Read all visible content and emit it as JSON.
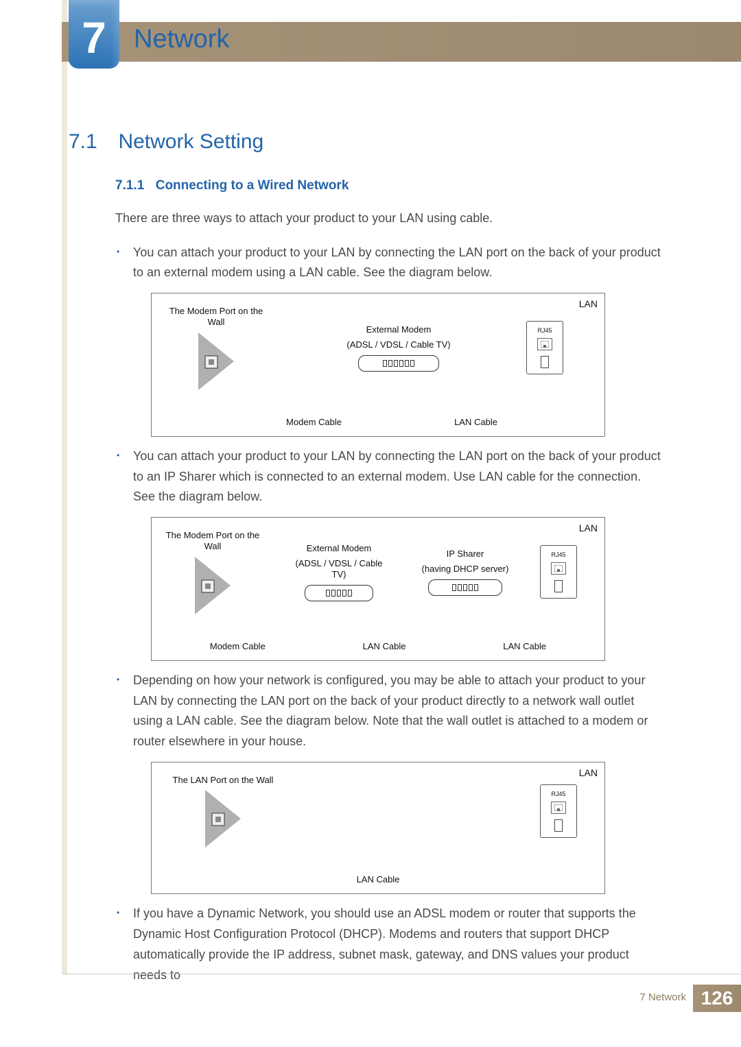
{
  "chapter": {
    "number": "7",
    "title": "Network"
  },
  "section": {
    "number": "7.1",
    "title": "Network Setting"
  },
  "subsection": {
    "number": "7.1.1",
    "title": "Connecting to a Wired Network"
  },
  "intro": "There are three ways to attach your product to your LAN using cable.",
  "bullets": [
    "You can attach your product to your LAN by connecting the LAN port on the back of your product to an external modem using a LAN cable. See the diagram below.",
    "You can attach your product to your LAN by connecting the LAN port on the back of your product to an IP Sharer which is connected to an external modem. Use LAN cable for the connection. See the diagram below.",
    "Depending on how your network is configured, you may be able to attach your product to your LAN by connecting the LAN port on the back of your product directly to a network wall outlet using a LAN cable. See the diagram below. Note that the wall outlet is attached to a modem or router elsewhere in your house.",
    "If you have a Dynamic Network, you should use an ADSL modem or router that supports the Dynamic Host Configuration Protocol (DHCP). Modems and routers that support DHCP automatically provide the IP address, subnet mask, gateway, and DNS values your product needs to"
  ],
  "diagram_labels": {
    "wall_modem": "The Modem Port on the Wall",
    "wall_lan": "The LAN Port on the Wall",
    "ext_modem_l1": "External Modem",
    "ext_modem_l2": "(ADSL / VDSL / Cable TV)",
    "ip_sharer_l1": "IP Sharer",
    "ip_sharer_l2": "(having DHCP server)",
    "lan": "LAN",
    "rj45": "RJ45",
    "modem_cable": "Modem Cable",
    "lan_cable": "LAN Cable"
  },
  "footer": {
    "label": "7 Network",
    "page": "126"
  }
}
